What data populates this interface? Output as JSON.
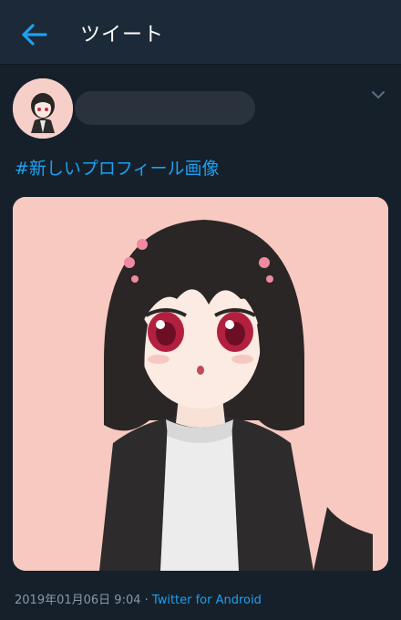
{
  "header": {
    "title": "ツイート"
  },
  "tweet": {
    "hashtag_text": "#新しいプロフィール画像",
    "timestamp": "2019年01月06日 9:04",
    "separator": " · ",
    "source": "Twitter for Android"
  },
  "colors": {
    "background": "#15202b",
    "header_bg": "#1c2938",
    "accent": "#1da1f2",
    "muted": "#8899a6",
    "image_bg": "#f7c9c1"
  },
  "icons": {
    "back": "arrow-left-icon",
    "caret": "chevron-down-icon"
  }
}
